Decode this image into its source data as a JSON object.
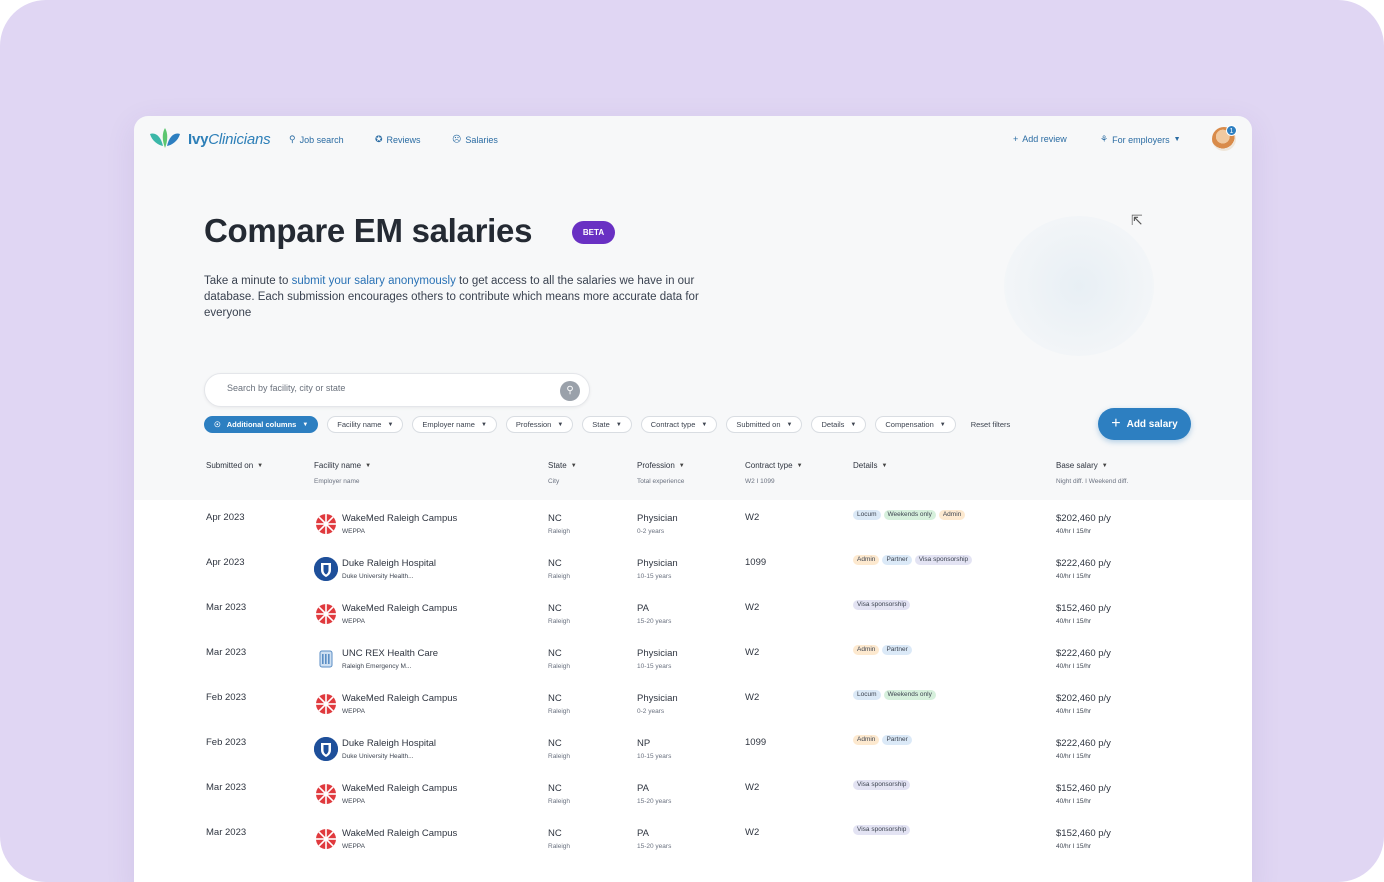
{
  "brand": {
    "logo_text_bold": "Ivy",
    "logo_text_italic": "Clinicians"
  },
  "nav": {
    "links": [
      {
        "label": "Job search",
        "icon": "search-icon"
      },
      {
        "label": "Reviews",
        "icon": "star-icon"
      },
      {
        "label": "Salaries",
        "icon": "money-bag-icon"
      }
    ],
    "add_review": "Add review",
    "for_employers": "For employers",
    "notification_count": "1"
  },
  "hero": {
    "title": "Compare EM salaries",
    "badge": "BETA",
    "desc_before": "Take a minute to ",
    "desc_link": "submit your salary anonymously",
    "desc_after": " to get access to all the salaries we have in our database. Each submission encourages others to contribute which means more accurate data for everyone"
  },
  "search": {
    "placeholder": "Search by facility, city or state"
  },
  "filters": {
    "chips": [
      "Additional columns",
      "Facility name",
      "Employer name",
      "Profession",
      "State",
      "Contract type",
      "Submitted on",
      "Details",
      "Compensation"
    ],
    "reset": "Reset filters",
    "add_salary": "Add salary"
  },
  "table": {
    "headers": [
      {
        "label": "Submitted on",
        "sub": ""
      },
      {
        "label": "Facility name",
        "sub": "Employer name"
      },
      {
        "label": "State",
        "sub": "City"
      },
      {
        "label": "Profession",
        "sub": "Total experience"
      },
      {
        "label": "Contract type",
        "sub": "W2   I   1099"
      },
      {
        "label": "Details",
        "sub": ""
      },
      {
        "label": "Base salary",
        "sub": "Night diff.   I   Weekend diff."
      }
    ],
    "rows": [
      {
        "date": "Apr 2023",
        "logo": "wakemed",
        "facility": "WakeMed Raleigh Campus",
        "employer": "WEPPA",
        "state": "NC",
        "city": "Raleigh",
        "profession": "Physician",
        "experience": "0-2 years",
        "contract": "W2",
        "tags": [
          {
            "text": "Locum",
            "color": "blue"
          },
          {
            "text": "Weekends only",
            "color": "green"
          },
          {
            "text": "Admin",
            "color": "peach"
          }
        ],
        "salary": "$202,460 p/y",
        "diffs": "40/hr   I   15/hr"
      },
      {
        "date": "Apr 2023",
        "logo": "duke",
        "facility": "Duke Raleigh Hospital",
        "employer": "Duke University Health...",
        "state": "NC",
        "city": "Raleigh",
        "profession": "Physician",
        "experience": "10-15 years",
        "contract": "1099",
        "tags": [
          {
            "text": "Admin",
            "color": "peach"
          },
          {
            "text": "Partner",
            "color": "blue"
          },
          {
            "text": "Visa sponsorship",
            "color": "lav"
          }
        ],
        "salary": "$222,460 p/y",
        "diffs": "40/hr   I   15/hr"
      },
      {
        "date": "Mar 2023",
        "logo": "wakemed",
        "facility": "WakeMed Raleigh Campus",
        "employer": "WEPPA",
        "state": "NC",
        "city": "Raleigh",
        "profession": "PA",
        "experience": "15-20 years",
        "contract": "W2",
        "tags": [
          {
            "text": "Visa sponsorship",
            "color": "lav"
          }
        ],
        "salary": "$152,460 p/y",
        "diffs": "40/hr   I   15/hr"
      },
      {
        "date": "Mar 2023",
        "logo": "unc",
        "facility": "UNC REX Health Care",
        "employer": "Raleigh Emergency M...",
        "state": "NC",
        "city": "Raleigh",
        "profession": "Physician",
        "experience": "10-15 years",
        "contract": "W2",
        "tags": [
          {
            "text": "Admin",
            "color": "peach"
          },
          {
            "text": "Partner",
            "color": "blue"
          }
        ],
        "salary": "$222,460 p/y",
        "diffs": "40/hr   I   15/hr"
      },
      {
        "date": "Feb 2023",
        "logo": "wakemed",
        "facility": "WakeMed Raleigh Campus",
        "employer": "WEPPA",
        "state": "NC",
        "city": "Raleigh",
        "profession": "Physician",
        "experience": "0-2 years",
        "contract": "W2",
        "tags": [
          {
            "text": "Locum",
            "color": "blue"
          },
          {
            "text": "Weekends only",
            "color": "green"
          }
        ],
        "salary": "$202,460 p/y",
        "diffs": "40/hr   I   15/hr"
      },
      {
        "date": "Feb 2023",
        "logo": "duke",
        "facility": "Duke Raleigh Hospital",
        "employer": "Duke University Health...",
        "state": "NC",
        "city": "Raleigh",
        "profession": "NP",
        "experience": "10-15 years",
        "contract": "1099",
        "tags": [
          {
            "text": "Admin",
            "color": "peach"
          },
          {
            "text": "Partner",
            "color": "blue"
          }
        ],
        "salary": "$222,460 p/y",
        "diffs": "40/hr   I   15/hr"
      },
      {
        "date": "Mar 2023",
        "logo": "wakemed",
        "facility": "WakeMed Raleigh Campus",
        "employer": "WEPPA",
        "state": "NC",
        "city": "Raleigh",
        "profession": "PA",
        "experience": "15-20 years",
        "contract": "W2",
        "tags": [
          {
            "text": "Visa sponsorship",
            "color": "lav"
          }
        ],
        "salary": "$152,460 p/y",
        "diffs": "40/hr   I   15/hr"
      },
      {
        "date": "Mar 2023",
        "logo": "wakemed",
        "facility": "WakeMed Raleigh Campus",
        "employer": "WEPPA",
        "state": "NC",
        "city": "Raleigh",
        "profession": "PA",
        "experience": "15-20 years",
        "contract": "W2",
        "tags": [
          {
            "text": "Visa sponsorship",
            "color": "lav"
          }
        ],
        "salary": "$152,460 p/y",
        "diffs": "40/hr   I   15/hr"
      }
    ]
  },
  "colors": {
    "background": "#e0d6f3",
    "primary": "#2d7fc1",
    "beta": "#6930c3",
    "link": "#2a72b5"
  }
}
